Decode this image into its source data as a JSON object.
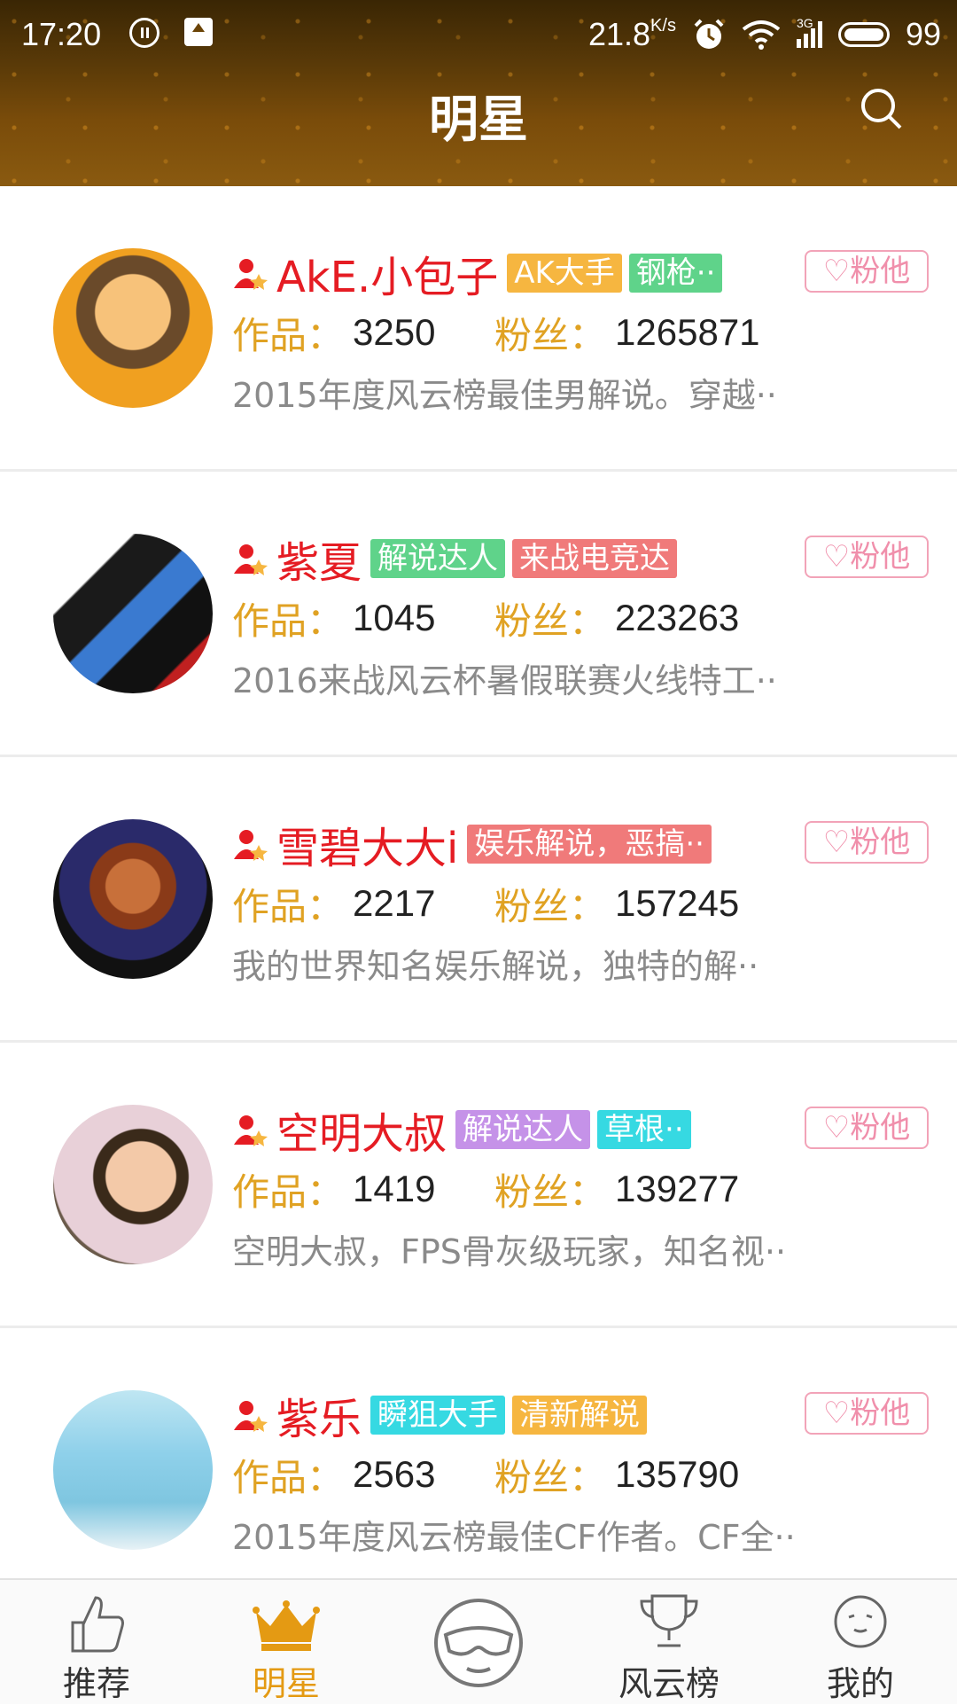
{
  "status_bar": {
    "time": "17:20",
    "speed": "21.8",
    "speed_unit": "K/s",
    "network": "3G",
    "battery": "99"
  },
  "header": {
    "title": "明星"
  },
  "colors": {
    "accent": "#e49a13",
    "name_red": "#e51c23",
    "label_gold": "#e0a223",
    "fans_pink": "#f08fab"
  },
  "celebrities": [
    {
      "name": "AkE.小包子",
      "tags": [
        {
          "text": "AK大手",
          "color": "#f6b640"
        },
        {
          "text": "钢枪··",
          "color": "#5fd38a"
        }
      ],
      "works_label": "作品：",
      "works": "3250",
      "fans_label": "粉丝：",
      "fans": "1265871",
      "follow": "♡粉他",
      "desc": "2015年度风云榜最佳男解说。穿越··"
    },
    {
      "name": "紫夏",
      "tags": [
        {
          "text": "解说达人",
          "color": "#5fd38a"
        },
        {
          "text": "来战电竞达",
          "color": "#f07a7a"
        }
      ],
      "works_label": "作品：",
      "works": "1045",
      "fans_label": "粉丝：",
      "fans": "223263",
      "follow": "♡粉他",
      "desc": "2016来战风云杯暑假联赛火线特工··"
    },
    {
      "name": "雪碧大大i",
      "tags": [
        {
          "text": "娱乐解说，恶搞··",
          "color": "#f07a7a"
        }
      ],
      "works_label": "作品：",
      "works": "2217",
      "fans_label": "粉丝：",
      "fans": "157245",
      "follow": "♡粉他",
      "desc": "我的世界知名娱乐解说，独特的解··"
    },
    {
      "name": "空明大叔",
      "tags": [
        {
          "text": "解说达人",
          "color": "#c592e8"
        },
        {
          "text": "草根··",
          "color": "#36d9e2"
        }
      ],
      "works_label": "作品：",
      "works": "1419",
      "fans_label": "粉丝：",
      "fans": "139277",
      "follow": "♡粉他",
      "desc": "空明大叔，FPS骨灰级玩家，知名视··"
    },
    {
      "name": "紫乐",
      "tags": [
        {
          "text": "瞬狙大手",
          "color": "#36d9e2"
        },
        {
          "text": "清新解说",
          "color": "#f6b640"
        }
      ],
      "works_label": "作品：",
      "works": "2563",
      "fans_label": "粉丝：",
      "fans": "135790",
      "follow": "♡粉他",
      "desc": "2015年度风云榜最佳CF作者。CF全··"
    }
  ],
  "nav": [
    {
      "label": "推荐",
      "icon": "thumbs-up-icon"
    },
    {
      "label": "明星",
      "icon": "crown-icon",
      "active": true
    },
    {
      "label": "",
      "icon": "goggles-face-icon"
    },
    {
      "label": "风云榜",
      "icon": "trophy-icon"
    },
    {
      "label": "我的",
      "icon": "face-icon"
    }
  ]
}
